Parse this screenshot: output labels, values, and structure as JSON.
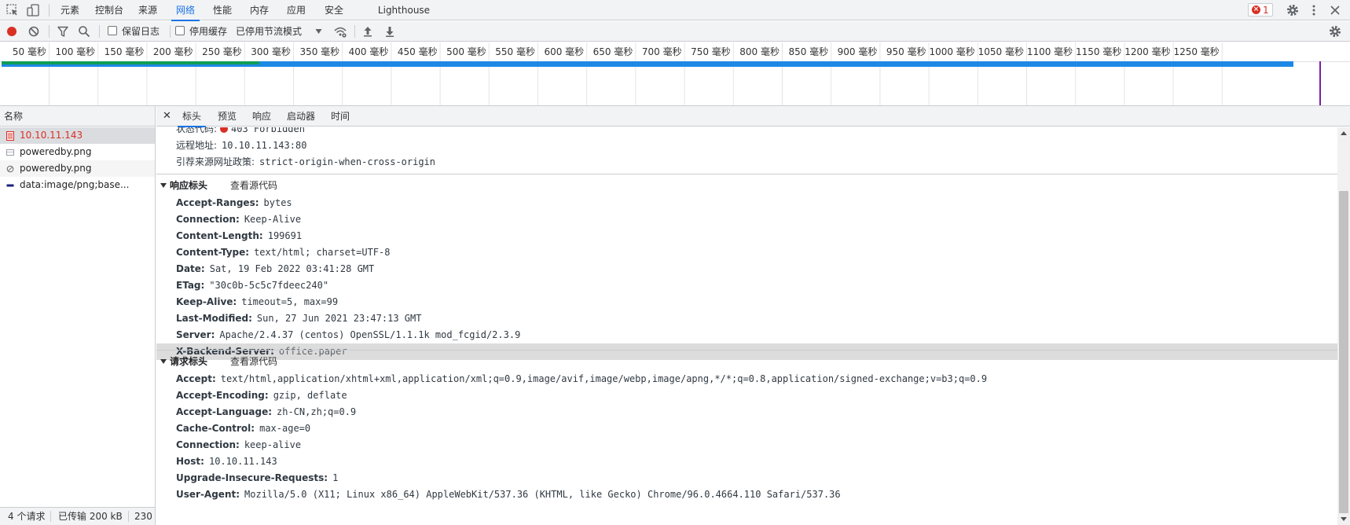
{
  "top_tabs": [
    "元素",
    "控制台",
    "来源",
    "网络",
    "性能",
    "内存",
    "应用",
    "安全",
    "Lighthouse"
  ],
  "error_count": "1",
  "toolbar": {
    "preserve_log": "保留日志",
    "disable_cache": "停用缓存",
    "throttle": "已停用节流模式"
  },
  "timeline": {
    "ticks": [
      "50 毫秒",
      "100 毫秒",
      "150 毫秒",
      "200 毫秒",
      "250 毫秒",
      "300 毫秒",
      "350 毫秒",
      "400 毫秒",
      "450 毫秒",
      "500 毫秒",
      "550 毫秒",
      "600 毫秒",
      "650 毫秒",
      "700 毫秒",
      "750 毫秒",
      "800 毫秒",
      "850 毫秒",
      "900 毫秒",
      "950 毫秒",
      "1000 毫秒",
      "1050 毫秒",
      "1100 毫秒",
      "1150 毫秒",
      "1200 毫秒",
      "1250 毫秒"
    ]
  },
  "requests": {
    "header": "名称",
    "rows": [
      "10.10.11.143",
      "poweredby.png",
      "poweredby.png",
      "data:image/png;base..."
    ]
  },
  "statusbar": {
    "requests": "4 个请求",
    "transferred": "已传输 200 kB",
    "more": "230"
  },
  "detail_tabs": [
    "标头",
    "预览",
    "响应",
    "启动器",
    "时间"
  ],
  "general": [
    {
      "key": "状态代码:",
      "value": "403 Forbidden"
    },
    {
      "key": "远程地址:",
      "value": "10.10.11.143:80"
    },
    {
      "key": "引荐来源网址政策:",
      "value": "strict-origin-when-cross-origin"
    }
  ],
  "response_headers": {
    "title": "响应标头",
    "view_source": "查看源代码",
    "rows": [
      {
        "key": "Accept-Ranges:",
        "value": "bytes"
      },
      {
        "key": "Connection:",
        "value": "Keep-Alive"
      },
      {
        "key": "Content-Length:",
        "value": "199691"
      },
      {
        "key": "Content-Type:",
        "value": "text/html; charset=UTF-8"
      },
      {
        "key": "Date:",
        "value": "Sat, 19 Feb 2022 03:41:28 GMT"
      },
      {
        "key": "ETag:",
        "value": "\"30c0b-5c5c7fdeec240\""
      },
      {
        "key": "Keep-Alive:",
        "value": "timeout=5, max=99"
      },
      {
        "key": "Last-Modified:",
        "value": "Sun, 27 Jun 2021 23:47:13 GMT"
      },
      {
        "key": "Server:",
        "value": "Apache/2.4.37 (centos) OpenSSL/1.1.1k mod_fcgid/2.3.9"
      },
      {
        "key": "X-Backend-Server:",
        "value": "office.paper"
      }
    ]
  },
  "request_headers": {
    "title": "请求标头",
    "view_source": "查看源代码",
    "rows": [
      {
        "key": "Accept:",
        "value": "text/html,application/xhtml+xml,application/xml;q=0.9,image/avif,image/webp,image/apng,*/*;q=0.8,application/signed-exchange;v=b3;q=0.9"
      },
      {
        "key": "Accept-Encoding:",
        "value": "gzip, deflate"
      },
      {
        "key": "Accept-Language:",
        "value": "zh-CN,zh;q=0.9"
      },
      {
        "key": "Cache-Control:",
        "value": "max-age=0"
      },
      {
        "key": "Connection:",
        "value": "keep-alive"
      },
      {
        "key": "Host:",
        "value": "10.10.11.143"
      },
      {
        "key": "Upgrade-Insecure-Requests:",
        "value": "1"
      },
      {
        "key": "User-Agent:",
        "value": "Mozilla/5.0 (X11; Linux x86_64) AppleWebKit/537.36 (KHTML, like Gecko) Chrome/96.0.4664.110 Safari/537.36"
      }
    ]
  }
}
